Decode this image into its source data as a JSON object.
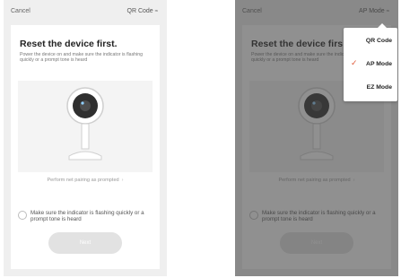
{
  "left_screen": {
    "cancel": "Cancel",
    "mode": "QR Code",
    "title": "Reset the device first.",
    "instruction": "Power the device on and make sure the indicator is flashing quickly or a prompt tone is heard",
    "pairing_link": "Perform net pairing as prompted",
    "checkbox_label": "Make sure the indicator is flashing quickly or a prompt tone is heard",
    "next_button": "Next"
  },
  "right_screen": {
    "cancel": "Cancel",
    "mode": "AP Mode",
    "title": "Reset the device firs",
    "instruction": "Power the device on and make sure the indicator is flashing quickly or a prompt tone is heard",
    "pairing_link": "Perform net pairing as prompted",
    "checkbox_label": "Make sure the indicator is flashing quickly or a prompt tone is heard",
    "next_button": "Next",
    "dropdown": {
      "items": [
        {
          "label": "QR Code",
          "selected": false
        },
        {
          "label": "AP Mode",
          "selected": true
        },
        {
          "label": "EZ Mode",
          "selected": false
        }
      ]
    }
  },
  "icons": {
    "chevron": "chevron-down-icon",
    "arrow": "chevron-right-icon",
    "checkmark": "checkmark-icon",
    "camera": "camera-icon"
  },
  "colors": {
    "accent": "#e05a3a",
    "overlay": "#404040"
  }
}
